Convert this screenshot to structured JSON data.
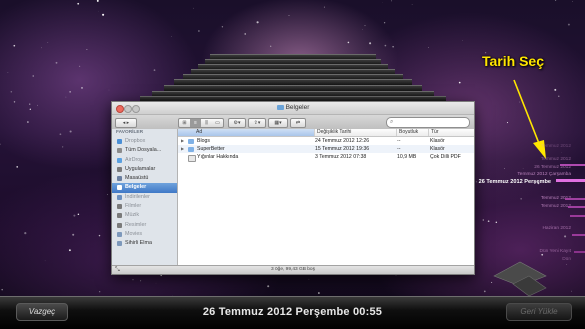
{
  "window": {
    "title": "Belgeler",
    "search_placeholder": "",
    "status": "3 öğe, 99,43 GB boş"
  },
  "sidebar": {
    "header": "FAVORİLER",
    "items": [
      {
        "label": "Dropbox",
        "icon": "dropbox-icon",
        "dim": true
      },
      {
        "label": "Tüm Dosyala...",
        "icon": "all-files-icon",
        "dim": false
      },
      {
        "label": "AirDrop",
        "icon": "airdrop-icon",
        "dim": true
      },
      {
        "label": "Uygulamalar",
        "icon": "applications-icon",
        "dim": false
      },
      {
        "label": "Masaüstü",
        "icon": "desktop-icon",
        "dim": false
      },
      {
        "label": "Belgeler",
        "icon": "documents-icon",
        "dim": false,
        "selected": true
      },
      {
        "label": "İndirilenler",
        "icon": "downloads-icon",
        "dim": true
      },
      {
        "label": "Filmler",
        "icon": "movies-icon",
        "dim": true
      },
      {
        "label": "Müzik",
        "icon": "music-icon",
        "dim": true
      },
      {
        "label": "Resimler",
        "icon": "pictures-icon",
        "dim": true
      },
      {
        "label": "Movies",
        "icon": "folder-icon",
        "dim": true
      },
      {
        "label": "Sihirli Elma",
        "icon": "folder-icon",
        "dim": false
      }
    ]
  },
  "columns": {
    "name": "Ad",
    "date": "Değişiklik Tarihi",
    "size": "Boyutluk",
    "kind": "Tür"
  },
  "files": [
    {
      "name": "Blogs",
      "date": "24 Temmuz 2012 12:26",
      "size": "--",
      "kind": "Klasör",
      "folder": true
    },
    {
      "name": "SuperBetter",
      "date": "15 Temmuz 2012 19:36",
      "size": "--",
      "kind": "Klasör",
      "folder": true
    },
    {
      "name": "Yığınlar Hakkında",
      "date": "3 Temmuz 2012 07:38",
      "size": "10,9 MB",
      "kind": "Çok Dilli PDF",
      "folder": false
    }
  ],
  "picker": {
    "title": "Tarih Seç",
    "selected_date": "26 Temmuz 2012 Perşembe",
    "dates_above": [
      "Temmuz 2012",
      "Temmuz 2012",
      "26 Temmuz 2012",
      "Temmuz 2012 Çarşamba"
    ],
    "dates_below": [
      "Temmuz 2012",
      "Temmuz 2012",
      "Haziran 2012",
      "Dün Yeni Kayıt",
      "Dün"
    ]
  },
  "bottom": {
    "cancel_label": "Vazgeç",
    "date_label": "26 Temmuz 2012 Perşembe 00:55",
    "restore_label": "Geri Yükle"
  },
  "colors": {
    "accent_yellow": "#ffe600",
    "selection_blue": "#3f78c6",
    "date_list_pink": "#d89ad8"
  }
}
